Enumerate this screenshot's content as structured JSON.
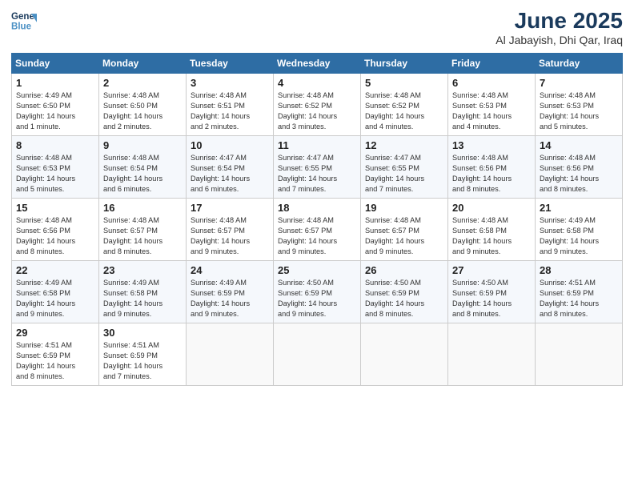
{
  "header": {
    "logo_line1": "General",
    "logo_line2": "Blue",
    "main_title": "June 2025",
    "sub_title": "Al Jabayish, Dhi Qar, Iraq"
  },
  "days_of_week": [
    "Sunday",
    "Monday",
    "Tuesday",
    "Wednesday",
    "Thursday",
    "Friday",
    "Saturday"
  ],
  "weeks": [
    [
      {
        "day": "1",
        "info": "Sunrise: 4:49 AM\nSunset: 6:50 PM\nDaylight: 14 hours\nand 1 minute."
      },
      {
        "day": "2",
        "info": "Sunrise: 4:48 AM\nSunset: 6:50 PM\nDaylight: 14 hours\nand 2 minutes."
      },
      {
        "day": "3",
        "info": "Sunrise: 4:48 AM\nSunset: 6:51 PM\nDaylight: 14 hours\nand 2 minutes."
      },
      {
        "day": "4",
        "info": "Sunrise: 4:48 AM\nSunset: 6:52 PM\nDaylight: 14 hours\nand 3 minutes."
      },
      {
        "day": "5",
        "info": "Sunrise: 4:48 AM\nSunset: 6:52 PM\nDaylight: 14 hours\nand 4 minutes."
      },
      {
        "day": "6",
        "info": "Sunrise: 4:48 AM\nSunset: 6:53 PM\nDaylight: 14 hours\nand 4 minutes."
      },
      {
        "day": "7",
        "info": "Sunrise: 4:48 AM\nSunset: 6:53 PM\nDaylight: 14 hours\nand 5 minutes."
      }
    ],
    [
      {
        "day": "8",
        "info": "Sunrise: 4:48 AM\nSunset: 6:53 PM\nDaylight: 14 hours\nand 5 minutes."
      },
      {
        "day": "9",
        "info": "Sunrise: 4:48 AM\nSunset: 6:54 PM\nDaylight: 14 hours\nand 6 minutes."
      },
      {
        "day": "10",
        "info": "Sunrise: 4:47 AM\nSunset: 6:54 PM\nDaylight: 14 hours\nand 6 minutes."
      },
      {
        "day": "11",
        "info": "Sunrise: 4:47 AM\nSunset: 6:55 PM\nDaylight: 14 hours\nand 7 minutes."
      },
      {
        "day": "12",
        "info": "Sunrise: 4:47 AM\nSunset: 6:55 PM\nDaylight: 14 hours\nand 7 minutes."
      },
      {
        "day": "13",
        "info": "Sunrise: 4:48 AM\nSunset: 6:56 PM\nDaylight: 14 hours\nand 8 minutes."
      },
      {
        "day": "14",
        "info": "Sunrise: 4:48 AM\nSunset: 6:56 PM\nDaylight: 14 hours\nand 8 minutes."
      }
    ],
    [
      {
        "day": "15",
        "info": "Sunrise: 4:48 AM\nSunset: 6:56 PM\nDaylight: 14 hours\nand 8 minutes."
      },
      {
        "day": "16",
        "info": "Sunrise: 4:48 AM\nSunset: 6:57 PM\nDaylight: 14 hours\nand 8 minutes."
      },
      {
        "day": "17",
        "info": "Sunrise: 4:48 AM\nSunset: 6:57 PM\nDaylight: 14 hours\nand 9 minutes."
      },
      {
        "day": "18",
        "info": "Sunrise: 4:48 AM\nSunset: 6:57 PM\nDaylight: 14 hours\nand 9 minutes."
      },
      {
        "day": "19",
        "info": "Sunrise: 4:48 AM\nSunset: 6:57 PM\nDaylight: 14 hours\nand 9 minutes."
      },
      {
        "day": "20",
        "info": "Sunrise: 4:48 AM\nSunset: 6:58 PM\nDaylight: 14 hours\nand 9 minutes."
      },
      {
        "day": "21",
        "info": "Sunrise: 4:49 AM\nSunset: 6:58 PM\nDaylight: 14 hours\nand 9 minutes."
      }
    ],
    [
      {
        "day": "22",
        "info": "Sunrise: 4:49 AM\nSunset: 6:58 PM\nDaylight: 14 hours\nand 9 minutes."
      },
      {
        "day": "23",
        "info": "Sunrise: 4:49 AM\nSunset: 6:58 PM\nDaylight: 14 hours\nand 9 minutes."
      },
      {
        "day": "24",
        "info": "Sunrise: 4:49 AM\nSunset: 6:59 PM\nDaylight: 14 hours\nand 9 minutes."
      },
      {
        "day": "25",
        "info": "Sunrise: 4:50 AM\nSunset: 6:59 PM\nDaylight: 14 hours\nand 9 minutes."
      },
      {
        "day": "26",
        "info": "Sunrise: 4:50 AM\nSunset: 6:59 PM\nDaylight: 14 hours\nand 8 minutes."
      },
      {
        "day": "27",
        "info": "Sunrise: 4:50 AM\nSunset: 6:59 PM\nDaylight: 14 hours\nand 8 minutes."
      },
      {
        "day": "28",
        "info": "Sunrise: 4:51 AM\nSunset: 6:59 PM\nDaylight: 14 hours\nand 8 minutes."
      }
    ],
    [
      {
        "day": "29",
        "info": "Sunrise: 4:51 AM\nSunset: 6:59 PM\nDaylight: 14 hours\nand 8 minutes."
      },
      {
        "day": "30",
        "info": "Sunrise: 4:51 AM\nSunset: 6:59 PM\nDaylight: 14 hours\nand 7 minutes."
      },
      {
        "day": "",
        "info": ""
      },
      {
        "day": "",
        "info": ""
      },
      {
        "day": "",
        "info": ""
      },
      {
        "day": "",
        "info": ""
      },
      {
        "day": "",
        "info": ""
      }
    ]
  ]
}
